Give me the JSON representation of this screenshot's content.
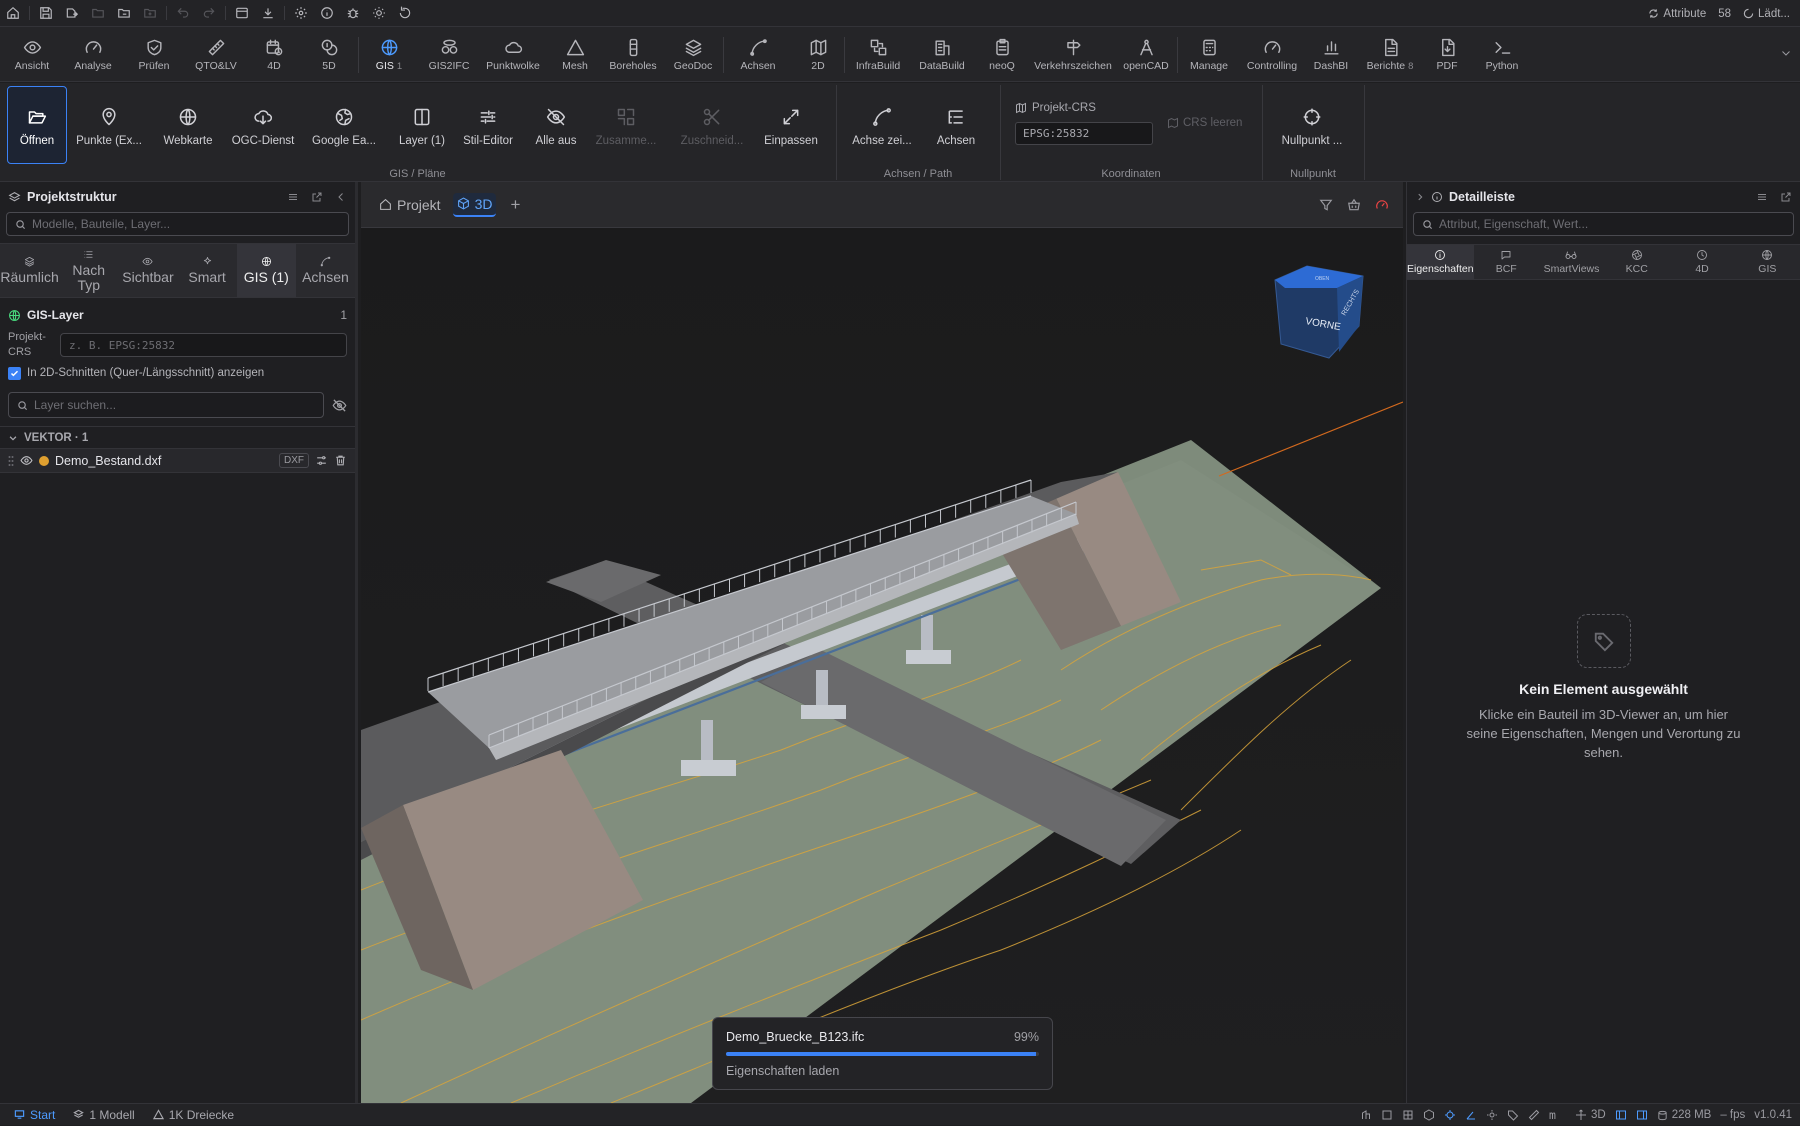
{
  "topbar": {
    "icons": [
      "home-icon",
      "save-icon",
      "save-as-icon",
      "open-folder-icon",
      "folder-icon",
      "folder-plus-icon",
      "undo-icon",
      "redo-icon",
      "window-icon",
      "download-icon",
      "settings-icon",
      "info-icon",
      "bug-icon",
      "sun-icon",
      "reload-icon"
    ],
    "attribute_label": "Attribute",
    "attribute_count": "58",
    "loading_label": "Lädt..."
  },
  "mainnav": {
    "items": [
      {
        "label": "Ansicht",
        "icon": "eye-icon"
      },
      {
        "label": "Analyse",
        "icon": "gauge-icon"
      },
      {
        "label": "Prüfen",
        "icon": "shield-check-icon"
      },
      {
        "label": "QTO&LV",
        "icon": "ruler-icon"
      },
      {
        "label": "4D",
        "icon": "calendar-clock-icon"
      },
      {
        "label": "5D",
        "icon": "coins-icon"
      },
      {
        "label": "GIS",
        "badge": "1",
        "icon": "globe-icon"
      },
      {
        "label": "GIS2IFC",
        "icon": "stack-icon"
      },
      {
        "label": "Punktwolke",
        "icon": "cloud-icon"
      },
      {
        "label": "Mesh",
        "icon": "triangle-icon"
      },
      {
        "label": "Boreholes",
        "icon": "borehole-icon"
      },
      {
        "label": "GeoDoc",
        "icon": "layers-icon"
      },
      {
        "label": "Achsen",
        "icon": "axis-curve-icon"
      },
      {
        "label": "2D",
        "icon": "map-icon"
      },
      {
        "label": "InfraBuild",
        "icon": "blocks-icon"
      },
      {
        "label": "DataBuild",
        "icon": "building-icon"
      },
      {
        "label": "neoQ",
        "icon": "clipboard-icon"
      },
      {
        "label": "Verkehrszeichen",
        "icon": "signpost-icon"
      },
      {
        "label": "openCAD",
        "icon": "compass-icon"
      },
      {
        "label": "Manage",
        "icon": "calculator-icon"
      },
      {
        "label": "Controlling",
        "icon": "gauge-icon"
      },
      {
        "label": "DashBI",
        "icon": "bar-chart-icon"
      },
      {
        "label": "Berichte",
        "badge": "8",
        "icon": "report-icon"
      },
      {
        "label": "PDF",
        "icon": "pdf-icon"
      },
      {
        "label": "Python",
        "icon": "terminal-icon"
      }
    ]
  },
  "ribbon": {
    "gis_group": {
      "label": "GIS / Pläne",
      "buttons": [
        {
          "label": "Öffnen",
          "icon": "folder-open-icon"
        },
        {
          "label": "Punkte (Ex...",
          "icon": "map-pin-icon"
        },
        {
          "label": "Webkarte",
          "icon": "globe-icon"
        },
        {
          "label": "OGC-Dienst",
          "icon": "cloud-download-icon"
        },
        {
          "label": "Google Ea...",
          "icon": "earth-icon"
        },
        {
          "label": "Layer (1)",
          "icon": "panel-icon"
        },
        {
          "label": "Stil-Editor",
          "icon": "sliders-icon"
        },
        {
          "label": "Alle aus",
          "icon": "eye-off-icon"
        },
        {
          "label": "Zusamme...",
          "icon": "merge-icon"
        },
        {
          "label": "Zuschneid...",
          "icon": "scissors-icon"
        },
        {
          "label": "Einpassen",
          "icon": "expand-icon"
        }
      ]
    },
    "axes_group": {
      "label": "Achsen / Path",
      "buttons": [
        {
          "label": "Achse zei...",
          "icon": "axis-draw-icon"
        },
        {
          "label": "Achsen",
          "icon": "list-tree-icon"
        }
      ]
    },
    "coord_group": {
      "label": "Koordinaten",
      "crs_title": "Projekt-CRS",
      "crs_value": "EPSG:25832",
      "clear_label": "CRS leeren"
    },
    "null_group": {
      "label": "Nullpunkt",
      "button": "Nullpunkt ..."
    }
  },
  "leftpanel": {
    "title": "Projektstruktur",
    "search_placeholder": "Modelle, Bauteile, Layer...",
    "tabs": [
      {
        "label": "Räumlich",
        "icon": "layers-icon"
      },
      {
        "label": "Nach\nTyp",
        "icon": "list-icon"
      },
      {
        "label": "Sichtbar",
        "icon": "eye-icon"
      },
      {
        "label": "Smart",
        "icon": "sparkle-icon"
      },
      {
        "label": "GIS (1)",
        "icon": "globe-icon"
      },
      {
        "label": "Achsen",
        "icon": "axis-curve-icon"
      }
    ],
    "gis_layer_title": "GIS-Layer",
    "gis_layer_count": "1",
    "crs_label": "Projekt-CRS",
    "crs_placeholder": "z. B. EPSG:25832",
    "checkbox_label": "In 2D-Schnitten (Quer-/Längsschnitt) anzeigen",
    "layer_search_placeholder": "Layer suchen...",
    "section_title": "VEKTOR · 1",
    "layer": {
      "name": "Demo_Bestand.dxf",
      "badge": "DXF",
      "color": "#e0a030"
    }
  },
  "viewer": {
    "tabs": [
      {
        "label": "Projekt",
        "icon": "home-icon"
      },
      {
        "label": "3D",
        "icon": "cube-icon"
      }
    ],
    "add_tab": "+",
    "nav_cube_front": "VORNE",
    "nav_cube_right": "RECHTS",
    "nav_cube_top": "OBEN",
    "progress": {
      "file": "Demo_Bruecke_B123.ifc",
      "percent_label": "99%",
      "fraction": 0.99,
      "status": "Eigenschaften laden"
    }
  },
  "rightpanel": {
    "title": "Detailleiste",
    "search_placeholder": "Attribut, Eigenschaft, Wert...",
    "tabs": [
      {
        "label": "Eigenschaften",
        "icon": "info-icon"
      },
      {
        "label": "BCF",
        "icon": "message-icon"
      },
      {
        "label": "SmartViews",
        "icon": "glasses-icon"
      },
      {
        "label": "KCC",
        "icon": "aperture-icon"
      },
      {
        "label": "4D",
        "icon": "clock-icon"
      },
      {
        "label": "GIS",
        "icon": "globe-icon"
      }
    ],
    "empty_title": "Kein Element ausgewählt",
    "empty_text": "Klicke ein Bauteil im 3D-Viewer an, um hier seine Eigenschaften, Mengen und Verortung zu sehen."
  },
  "statusbar": {
    "start": "Start",
    "models": "1 Modell",
    "triangles": "1K Dreiecke",
    "unit": "m",
    "mode": "3D",
    "memory": "228 MB",
    "fps": "– fps",
    "version": "v1.0.41"
  },
  "colors": {
    "accent": "#3b82f6",
    "layer_dot": "#e0a030",
    "terrain": "#7d8a7a",
    "contour": "#d9a53a",
    "axis_line": "#d2691e"
  }
}
